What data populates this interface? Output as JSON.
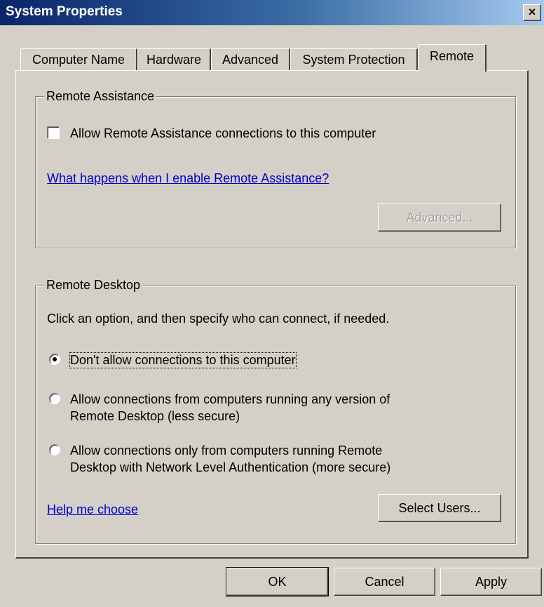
{
  "window": {
    "title": "System Properties",
    "close_glyph": "×"
  },
  "tabs": [
    "Computer Name",
    "Hardware",
    "Advanced",
    "System Protection",
    "Remote"
  ],
  "active_tab": "Remote",
  "remote_assistance": {
    "group_label": "Remote Assistance",
    "checkbox_label": "Allow Remote Assistance connections to this computer",
    "checked": false,
    "link": "What happens when I enable Remote Assistance?",
    "advanced_button": "Advanced..."
  },
  "remote_desktop": {
    "group_label": "Remote Desktop",
    "instruction": "Click an option, and then specify who can connect, if needed.",
    "options": [
      {
        "label": "Don't allow connections to this computer",
        "selected": true
      },
      {
        "line1": "Allow connections from computers running any version of",
        "line2": "Remote Desktop (less secure)",
        "selected": false
      },
      {
        "line1": "Allow connections only from computers running Remote",
        "line2": "Desktop with Network Level Authentication (more secure)",
        "selected": false
      }
    ],
    "help_link": "Help me choose",
    "select_users_button": "Select Users..."
  },
  "footer": {
    "ok": "OK",
    "cancel": "Cancel",
    "apply": "Apply"
  }
}
